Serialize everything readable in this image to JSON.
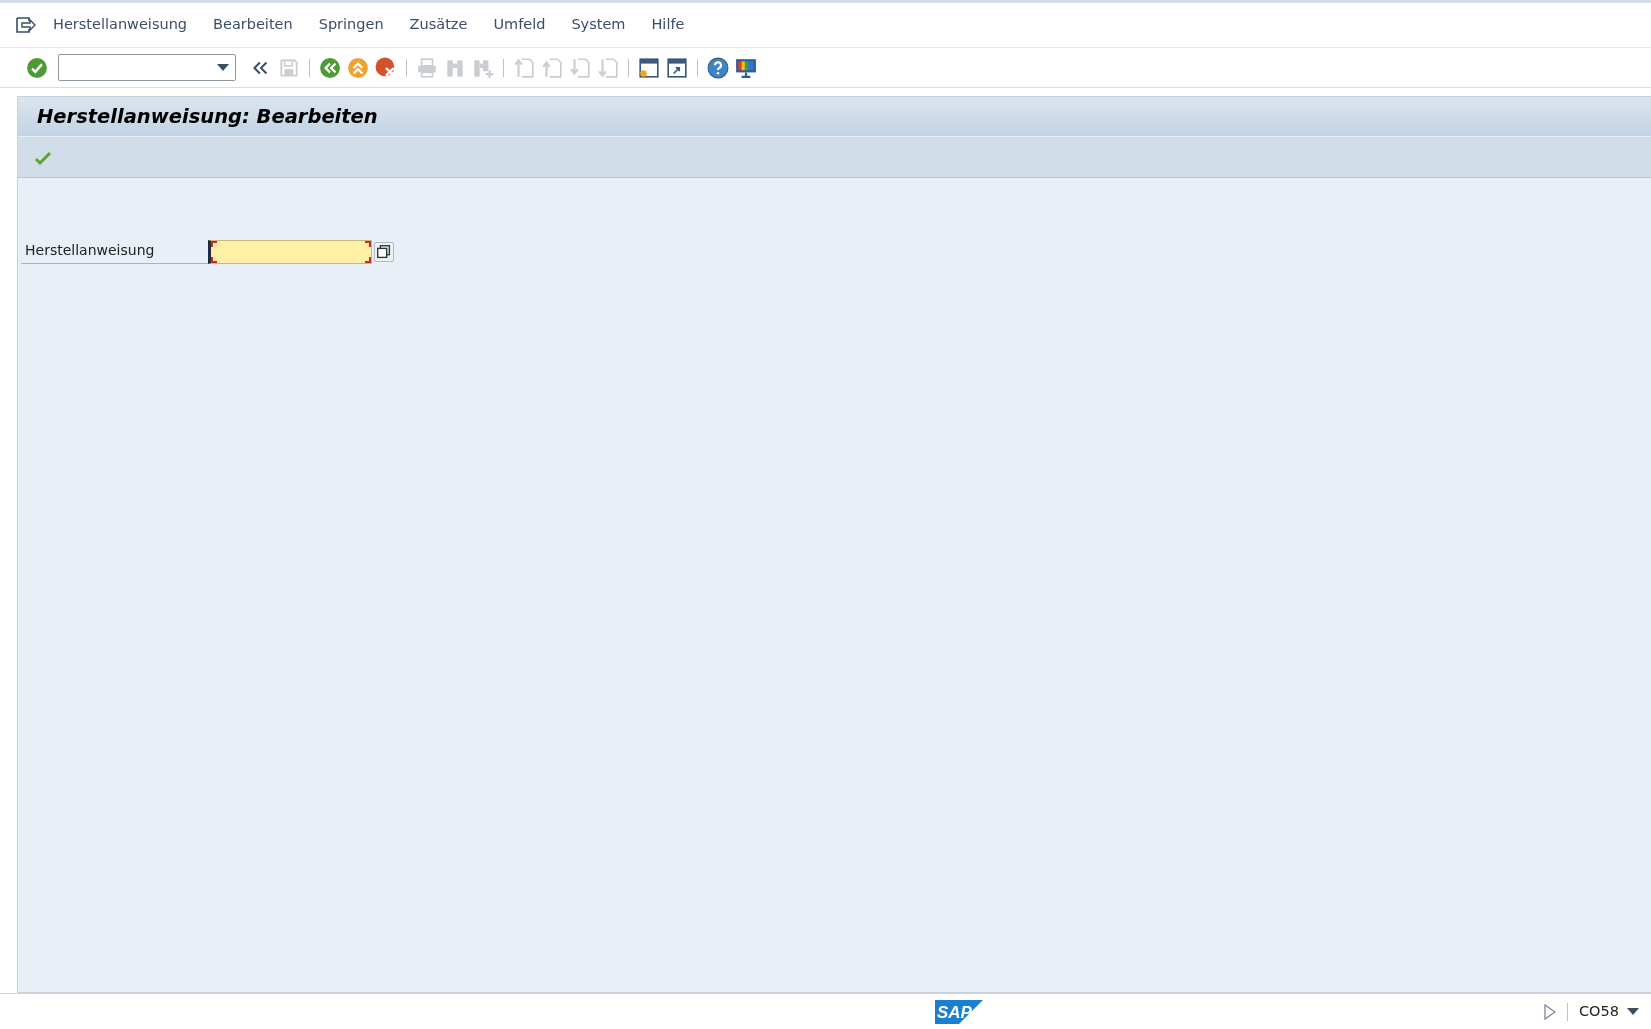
{
  "menu": [
    {
      "label": "Herstellanweisung"
    },
    {
      "label": "Bearbeiten"
    },
    {
      "label": "Springen"
    },
    {
      "label": "Zusätze"
    },
    {
      "label": "Umfeld"
    },
    {
      "label": "System"
    },
    {
      "label": "Hilfe"
    }
  ],
  "toolbar": {
    "buttons": [
      {
        "kind": "enter",
        "disabled": false
      },
      {
        "kind": "command",
        "disabled": false
      },
      {
        "kind": "collapse",
        "disabled": false
      },
      {
        "kind": "save",
        "disabled": true
      },
      {
        "kind": "separator"
      },
      {
        "kind": "back",
        "disabled": false
      },
      {
        "kind": "exit",
        "disabled": false
      },
      {
        "kind": "cancel",
        "disabled": false
      },
      {
        "kind": "separator"
      },
      {
        "kind": "print",
        "disabled": true
      },
      {
        "kind": "find",
        "disabled": true
      },
      {
        "kind": "findnext",
        "disabled": true
      },
      {
        "kind": "separator"
      },
      {
        "kind": "firstpage",
        "disabled": true
      },
      {
        "kind": "prevpage",
        "disabled": true
      },
      {
        "kind": "nextpage",
        "disabled": true
      },
      {
        "kind": "lastpage",
        "disabled": true
      },
      {
        "kind": "separator"
      },
      {
        "kind": "newsession",
        "disabled": false
      },
      {
        "kind": "shortcut",
        "disabled": false
      },
      {
        "kind": "separator"
      },
      {
        "kind": "help",
        "disabled": false
      },
      {
        "kind": "layout",
        "disabled": false
      }
    ]
  },
  "screen": {
    "title": "Herstellanweisung: Bearbeiten",
    "app_toolbar": [
      {
        "kind": "execute"
      }
    ],
    "fields": [
      {
        "label": "Herstellanweisung",
        "required": true,
        "focused": true
      }
    ]
  },
  "status_bar": {
    "logo": "SAP",
    "transaction": "CO58"
  }
}
